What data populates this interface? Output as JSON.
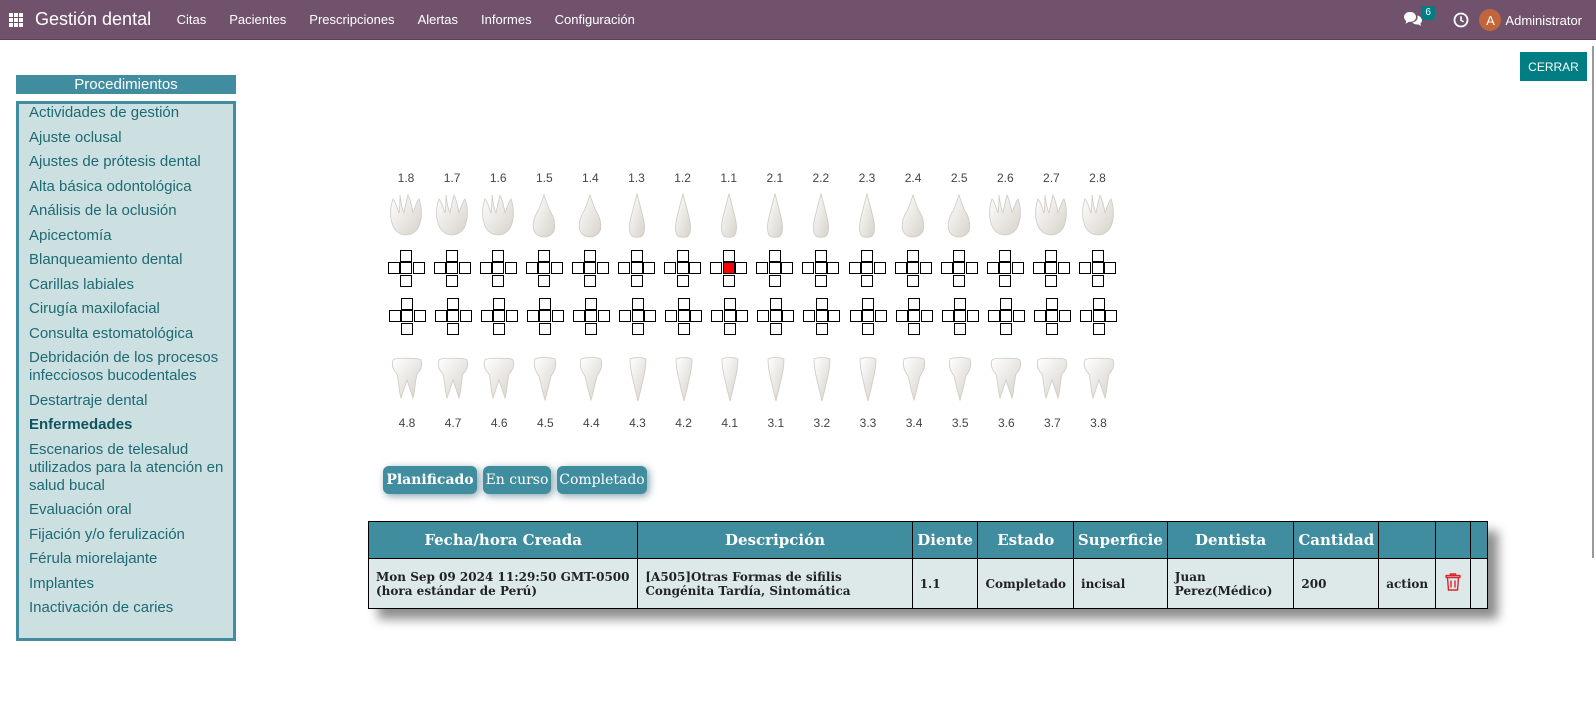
{
  "navbar": {
    "brand": "Gestión dental",
    "menu": [
      "Citas",
      "Pacientes",
      "Prescripciones",
      "Alertas",
      "Informes",
      "Configuración"
    ],
    "chat_count": "6",
    "avatar_letter": "A",
    "user_name": "Administrator"
  },
  "close_label": "CERRAR",
  "procedures": {
    "title": "Procedimientos",
    "items": [
      "Actividades de gestión",
      "Ajuste oclusal",
      "Ajustes de prótesis dental",
      "Alta básica odontológica",
      "Análisis de la oclusión",
      "Apicectomía",
      "Blanqueamiento dental",
      "Carillas labiales",
      "Cirugía maxilofacial",
      "Consulta estomatológica",
      "Debridación de los procesos infecciosos bucodentales",
      "Destartraje dental",
      "Enfermedades",
      "Escenarios de telesalud utilizados para la atención en salud bucal",
      "Evaluación oral",
      "Fijación y/o ferulización",
      "Férula miorelajante",
      "Implantes",
      "Inactivación de caries"
    ],
    "active_index": 12
  },
  "odontogram": {
    "upper_teeth": [
      "1.8",
      "1.7",
      "1.6",
      "1.5",
      "1.4",
      "1.3",
      "1.2",
      "1.1",
      "2.1",
      "2.2",
      "2.3",
      "2.4",
      "2.5",
      "2.6",
      "2.7",
      "2.8"
    ],
    "lower_teeth": [
      "4.8",
      "4.7",
      "4.6",
      "4.5",
      "4.4",
      "4.3",
      "4.2",
      "4.1",
      "3.1",
      "3.2",
      "3.3",
      "3.4",
      "3.5",
      "3.6",
      "3.7",
      "3.8"
    ],
    "marked_tooth": "1.1",
    "marked_surface": "incisal",
    "marked_color": "#ff0000"
  },
  "status_buttons": [
    "Planificado",
    "En curso",
    "Completado"
  ],
  "table": {
    "headers": [
      "Fecha/hora Creada",
      "Descripción",
      "Diente",
      "Estado",
      "Superficie",
      "Dentista",
      "Cantidad",
      "",
      ""
    ],
    "rows": [
      {
        "fecha": "Mon Sep 09 2024 11:29:50 GMT-0500 (hora estándar de Perú)",
        "descripcion": "[A505]Otras Formas de sifilis Congénita Tardía, Sintomática",
        "diente": "1.1",
        "estado": "Completado",
        "superficie": "incisal",
        "dentista": "Juan Perez(Médico)",
        "cantidad": "200",
        "action": "action"
      }
    ]
  },
  "colors": {
    "navbar": "#71526d",
    "teal": "#3f8d9e",
    "panel": "#cde0e1",
    "button": "#017e84"
  }
}
